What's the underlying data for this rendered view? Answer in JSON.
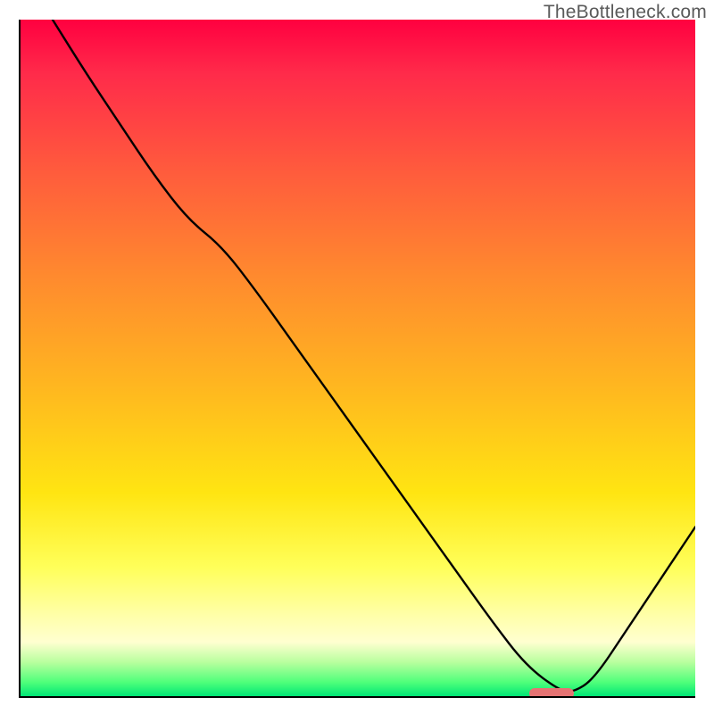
{
  "watermark": "TheBottleneck.com",
  "chart_data": {
    "type": "line",
    "title": "",
    "xlabel": "",
    "ylabel": "",
    "xlim": [
      0,
      100
    ],
    "ylim": [
      0,
      100
    ],
    "grid": false,
    "series": [
      {
        "name": "bottleneck-curve",
        "x": [
          5,
          10,
          15,
          20,
          25,
          30,
          35,
          40,
          45,
          50,
          55,
          60,
          65,
          70,
          75,
          80,
          82,
          85,
          90,
          95,
          100
        ],
        "values": [
          100,
          92,
          84.5,
          77,
          70.5,
          66.5,
          60,
          53,
          46,
          39,
          32,
          25,
          18,
          11,
          4.5,
          0.8,
          0.6,
          2.5,
          10,
          17.5,
          25
        ]
      }
    ],
    "marker": {
      "name": "optimal-range",
      "x_start": 75.5,
      "x_end": 82,
      "y": 0.4,
      "color": "#e57373"
    },
    "background": {
      "type": "heat-gradient",
      "top_color": "#ff0040",
      "mid_color": "#ffe512",
      "bottom_color": "#00e676"
    }
  }
}
